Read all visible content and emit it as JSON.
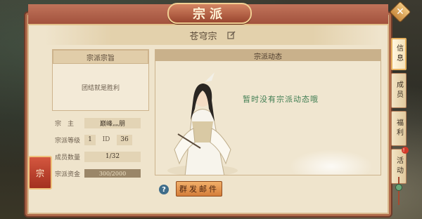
{
  "window": {
    "title": "宗派"
  },
  "sect": {
    "name": "苍穹宗"
  },
  "motto": {
    "header": "宗派宗旨",
    "text": "团结就是胜利"
  },
  "info": {
    "leader_label": "宗　主",
    "leader_value": "巅峰灬朋",
    "level_label": "宗派等级",
    "level_value": "1",
    "id_label": "ID",
    "id_value": "36",
    "members_label": "成员数量",
    "members_value": "1/32",
    "funds_label": "宗派资金",
    "funds_value": "300/2000"
  },
  "activity": {
    "header": "宗派动态",
    "empty_text": "暂时没有宗派动态哦"
  },
  "buttons": {
    "mail_label": "群发邮件",
    "help_label": "?"
  },
  "left_banner": {
    "label": "宗"
  },
  "tabs": [
    {
      "label": "信息",
      "active": true
    },
    {
      "label": "成员",
      "active": false
    },
    {
      "label": "福利",
      "active": false
    },
    {
      "label": "活动",
      "active": false,
      "badge": "!"
    }
  ],
  "close": {
    "label": "✕"
  },
  "colors": {
    "frame": "#b06a4a",
    "parchment": "#efe4cc",
    "accent_green": "#3f7d52",
    "button_orange": "#d47d3a"
  }
}
